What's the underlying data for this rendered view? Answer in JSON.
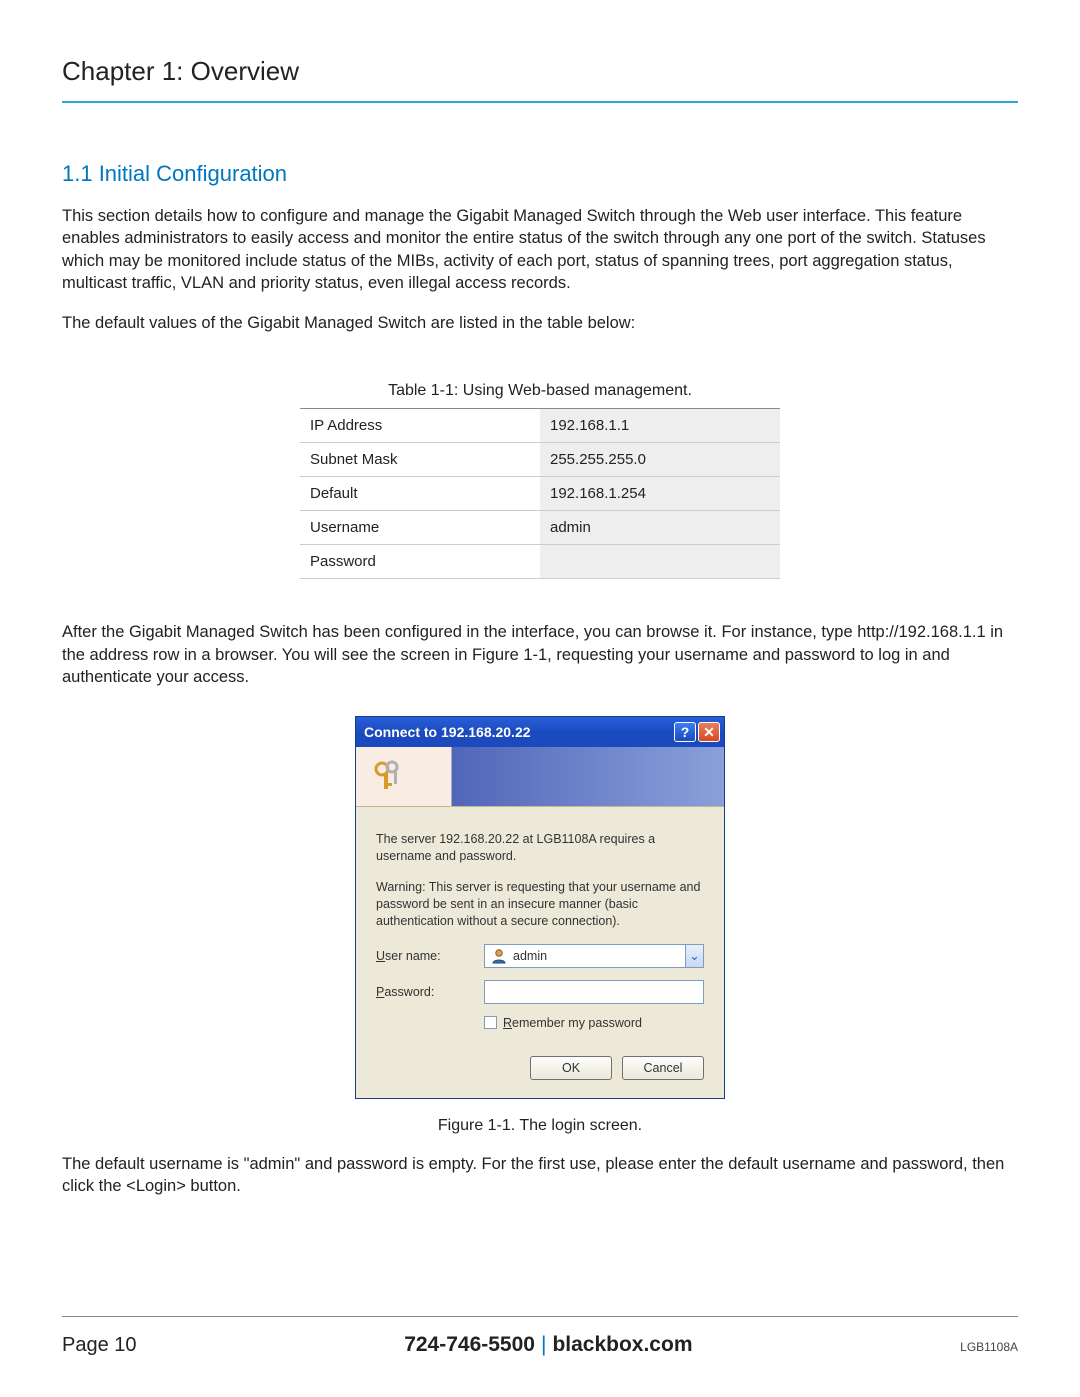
{
  "chapter_title": "Chapter 1: Overview",
  "section_title": "1.1 Initial Configuration",
  "para1": "This section details how to configure and manage the Gigabit Managed Switch through the Web user interface. This feature enables administrators to easily access and monitor the entire status of the switch through any one port of the switch. Statuses which may be monitored include status of the MIBs, activity of each port, status of spanning trees, port aggregation status, multicast traffic, VLAN and priority status, even illegal access records.",
  "para2": "The default values of the Gigabit Managed Switch are listed in the table below:",
  "table_caption": "Table 1-1: Using Web-based management.",
  "table_rows": [
    {
      "label": "IP Address",
      "value": "192.168.1.1"
    },
    {
      "label": "Subnet Mask",
      "value": "255.255.255.0"
    },
    {
      "label": "Default",
      "value": "192.168.1.254"
    },
    {
      "label": "Username",
      "value": "admin"
    },
    {
      "label": "Password",
      "value": ""
    }
  ],
  "para3": "After the Gigabit Managed Switch has been configured in the interface, you can browse it. For instance, type http://192.168.1.1 in the address row in a browser. You will see the screen in Figure 1-1, requesting your username and password to log in and authenticate your access.",
  "dialog": {
    "title": "Connect to 192.168.20.22",
    "help_glyph": "?",
    "close_glyph": "✕",
    "msg1": "The server 192.168.20.22 at LGB1108A requires a username and password.",
    "msg2": "Warning: This server is requesting that your username and password be sent in an insecure manner (basic authentication without a secure connection).",
    "username_label_pre": "U",
    "username_label_rest": "ser name:",
    "password_label_pre": "P",
    "password_label_rest": "assword:",
    "username_value": "admin",
    "password_value": "",
    "remember_pre": "R",
    "remember_rest": "emember my password",
    "ok_label": "OK",
    "cancel_label": "Cancel",
    "combo_arrow_glyph": "⌄"
  },
  "figure_caption": "Figure 1-1. The login screen.",
  "para4": "The default username is \"admin\" and password is empty. For the first use, please enter the default username and password, then click the <Login> button.",
  "footer": {
    "page_label": "Page 10",
    "phone": "724-746-5500",
    "sep": "|",
    "site": "blackbox.com",
    "model": "LGB1108A"
  }
}
